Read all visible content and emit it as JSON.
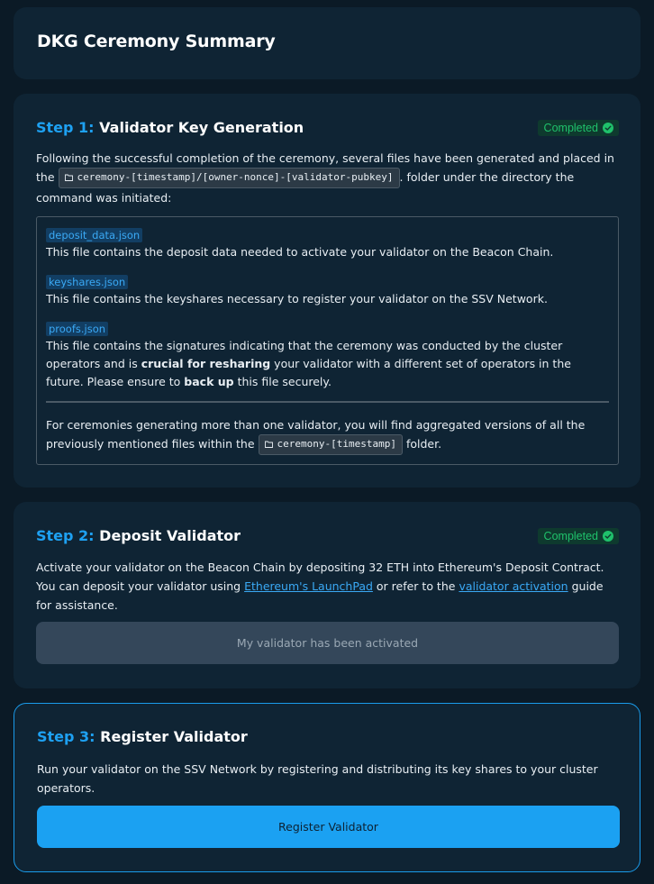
{
  "page_title": "DKG Ceremony Summary",
  "step1": {
    "step_label": "Step 1:",
    "title": "Validator Key Generation",
    "status": "Completed",
    "intro_before": "Following the successful completion of the ceremony, several files have been generated and placed in the",
    "folder_path": "ceremony-[timestamp]/[owner-nonce]-[validator-pubkey]",
    "intro_after": ". folder under the directory the command was initiated:",
    "files": [
      {
        "name": "deposit_data.json",
        "description": "This file contains the deposit data needed to activate your validator on the Beacon Chain."
      },
      {
        "name": "keyshares.json",
        "description": "This file contains the keyshares necessary to register your validator on the SSV Network."
      },
      {
        "name": "proofs.json",
        "desc_part1": "This file contains the signatures indicating that the ceremony was conducted by the cluster operators and is ",
        "desc_bold1": "crucial for resharing",
        "desc_part2": " your validator with a different set of operators in the future. Please ensure to ",
        "desc_bold2": "back up",
        "desc_part3": " this file securely."
      }
    ],
    "note_before": "For ceremonies generating more than one validator, you will find aggregated versions of all the previously mentioned files within the",
    "note_folder": "ceremony-[timestamp]",
    "note_after": " folder."
  },
  "step2": {
    "step_label": "Step 2:",
    "title": "Deposit Validator",
    "status": "Completed",
    "text_part1": "Activate your validator on the Beacon Chain by depositing 32 ETH into Ethereum's Deposit Contract. You can deposit your validator using ",
    "link1": "Ethereum's LaunchPad",
    "text_part2": " or refer to the ",
    "link2": "validator activation",
    "text_part3": " guide for assistance.",
    "button_label": "My validator has been activated"
  },
  "step3": {
    "step_label": "Step 3:",
    "title": "Register Validator",
    "text": "Run your validator on the SSV Network by registering and distributing its key shares to your cluster operators.",
    "button_label": "Register Validator"
  },
  "colors": {
    "background": "#0b1a26",
    "card": "#0f2434",
    "accent": "#1ea1f2",
    "success": "#1fc16b",
    "disabled_button": "#34475a"
  }
}
